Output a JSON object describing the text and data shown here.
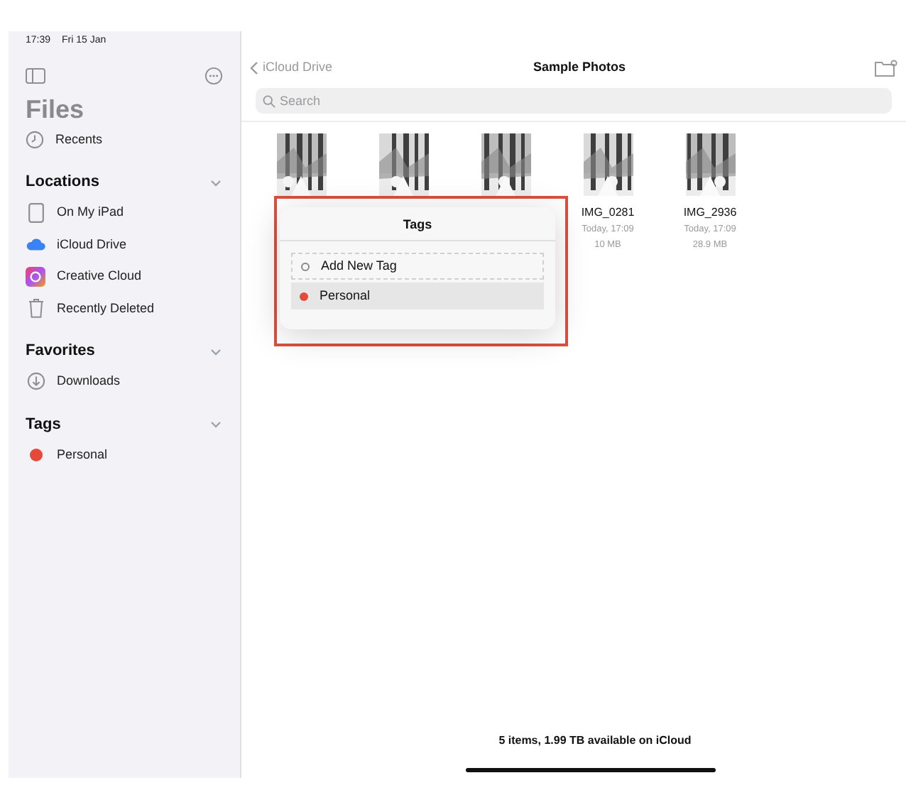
{
  "status_bar": {
    "time": "17:39",
    "date": "Fri 15 Jan"
  },
  "sidebar": {
    "title": "Files",
    "top_items": [
      {
        "label": "Recents",
        "kind": "clock",
        "selected": false
      }
    ],
    "sections": [
      {
        "title": "Locations",
        "expanded": true,
        "items": [
          {
            "label": "On My iPad",
            "kind": "ipad"
          },
          {
            "label": "iCloud Drive",
            "kind": "cloud"
          },
          {
            "label": "Creative Cloud",
            "kind": "cc"
          },
          {
            "label": "Recently Deleted",
            "kind": "trash"
          }
        ]
      },
      {
        "title": "Favorites",
        "expanded": true,
        "items": [
          {
            "label": "Downloads",
            "kind": "download"
          }
        ]
      },
      {
        "title": "Tags",
        "expanded": true,
        "items": [
          {
            "label": "Personal",
            "kind": "dot",
            "color": "#e5493a"
          }
        ]
      }
    ]
  },
  "header": {
    "back": "iCloud Drive",
    "title": "Sample Photos",
    "search": {
      "placeholder": "Search"
    }
  },
  "files": [
    {
      "kind": "picture"
    },
    {
      "kind": "picture"
    },
    {
      "kind": "picture"
    },
    {
      "kind": "picture",
      "name": "IMG_0281",
      "date": "Today, 17:09",
      "size": "10 MB"
    },
    {
      "kind": "picture",
      "name": "IMG_2936",
      "date": "Today, 17:09",
      "size": "28.9 MB"
    }
  ],
  "tags_popover": {
    "title": "Tags",
    "highlighted": true,
    "items": [
      {
        "kind": "add",
        "label": "Add New Tag",
        "selected": false
      },
      {
        "kind": "tag",
        "label": "Personal",
        "color": "#e5493a",
        "selected": true
      }
    ]
  },
  "footer": {
    "summary": "5 items, 1.99 TB available on iCloud"
  }
}
